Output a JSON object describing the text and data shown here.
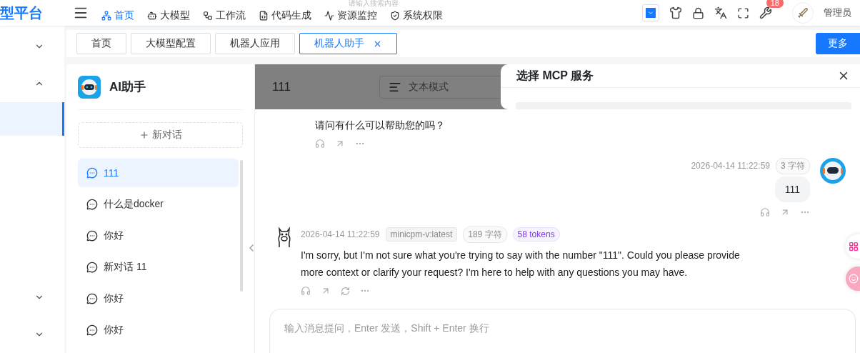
{
  "header": {
    "brand": "型平台",
    "nav": [
      {
        "label": "首页",
        "selected": true
      },
      {
        "label": "大模型",
        "selected": false
      },
      {
        "label": "工作流",
        "selected": false
      },
      {
        "label": "代码生成",
        "selected": false
      },
      {
        "label": "资源监控",
        "selected": false
      },
      {
        "label": "系统权限",
        "selected": false
      }
    ],
    "search": {
      "placeholder": "请输入搜索内容"
    },
    "notification_count": "18",
    "user": "管理员"
  },
  "sidebar": {
    "items": [
      {
        "kind": "group",
        "expanded": false
      },
      {
        "kind": "group",
        "expanded": true
      },
      {
        "kind": "link",
        "selected": true
      },
      {
        "kind": "group",
        "expanded": false
      },
      {
        "kind": "group",
        "expanded": false
      }
    ]
  },
  "tabs": [
    {
      "label": "首页",
      "selected": false
    },
    {
      "label": "大模型配置",
      "selected": false
    },
    {
      "label": "机器人应用",
      "selected": false
    },
    {
      "label": "机器人助手",
      "selected": true
    }
  ],
  "more_button": "更多",
  "assistant": {
    "title": "AI助手",
    "new_chat": "新对话",
    "conversations": [
      {
        "title": "111",
        "selected": true
      },
      {
        "title": "什么是docker",
        "selected": false
      },
      {
        "title": "你好",
        "selected": false
      },
      {
        "title": "新对话 11",
        "selected": false
      },
      {
        "title": "你好",
        "selected": false
      },
      {
        "title": "你好",
        "selected": false
      }
    ]
  },
  "chat": {
    "title": "111",
    "mode": "文本模式",
    "messages": [
      {
        "kind": "assistant",
        "text": "请问有什么可以帮助您的吗？"
      },
      {
        "kind": "user",
        "time": "2026-04-14 11:22:59",
        "chars": "3 字符",
        "text": "111"
      },
      {
        "kind": "assistant",
        "time": "2026-04-14 11:22:59",
        "model": "minicpm-v:latest",
        "chars": "189 字符",
        "tokens": "58 tokens",
        "text": "I'm sorry, but I'm not sure what you're trying to say with the number \"111\". Could you please provide more context or clarify your request? I'm here to help with any questions you may have."
      }
    ],
    "input_placeholder": "输入消息提问，Enter 发送，Shift + Enter 换行"
  },
  "drawer": {
    "title": "选择 MCP 服务"
  }
}
